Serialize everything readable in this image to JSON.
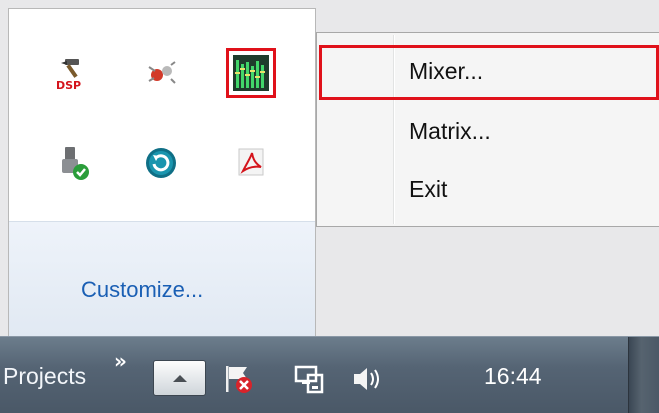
{
  "overflow_panel": {
    "icons": [
      {
        "name": "dsp-hammer-icon"
      },
      {
        "name": "network-bug-icon"
      },
      {
        "name": "mixer-equalizer-icon",
        "highlighted": true
      },
      {
        "name": "usb-connected-icon"
      },
      {
        "name": "sync-refresh-icon"
      },
      {
        "name": "acrobat-icon"
      }
    ],
    "dsp_badge": "DSP",
    "customize_label": "Customize..."
  },
  "context_menu": {
    "items": [
      {
        "label": "Mixer...",
        "highlighted": true
      },
      {
        "label": "Matrix..."
      },
      {
        "label": "Exit"
      }
    ]
  },
  "taskbar": {
    "button_label": "Projects",
    "overflow_chevron": "»",
    "clock": "16:44",
    "tray_icons": [
      "show-hidden-icons-arrow",
      "action-center-flag-icon",
      "network-icon",
      "volume-icon"
    ]
  },
  "colors": {
    "highlight_outline": "#e0111a",
    "link": "#1a5fb4",
    "taskbar": "#556474"
  }
}
